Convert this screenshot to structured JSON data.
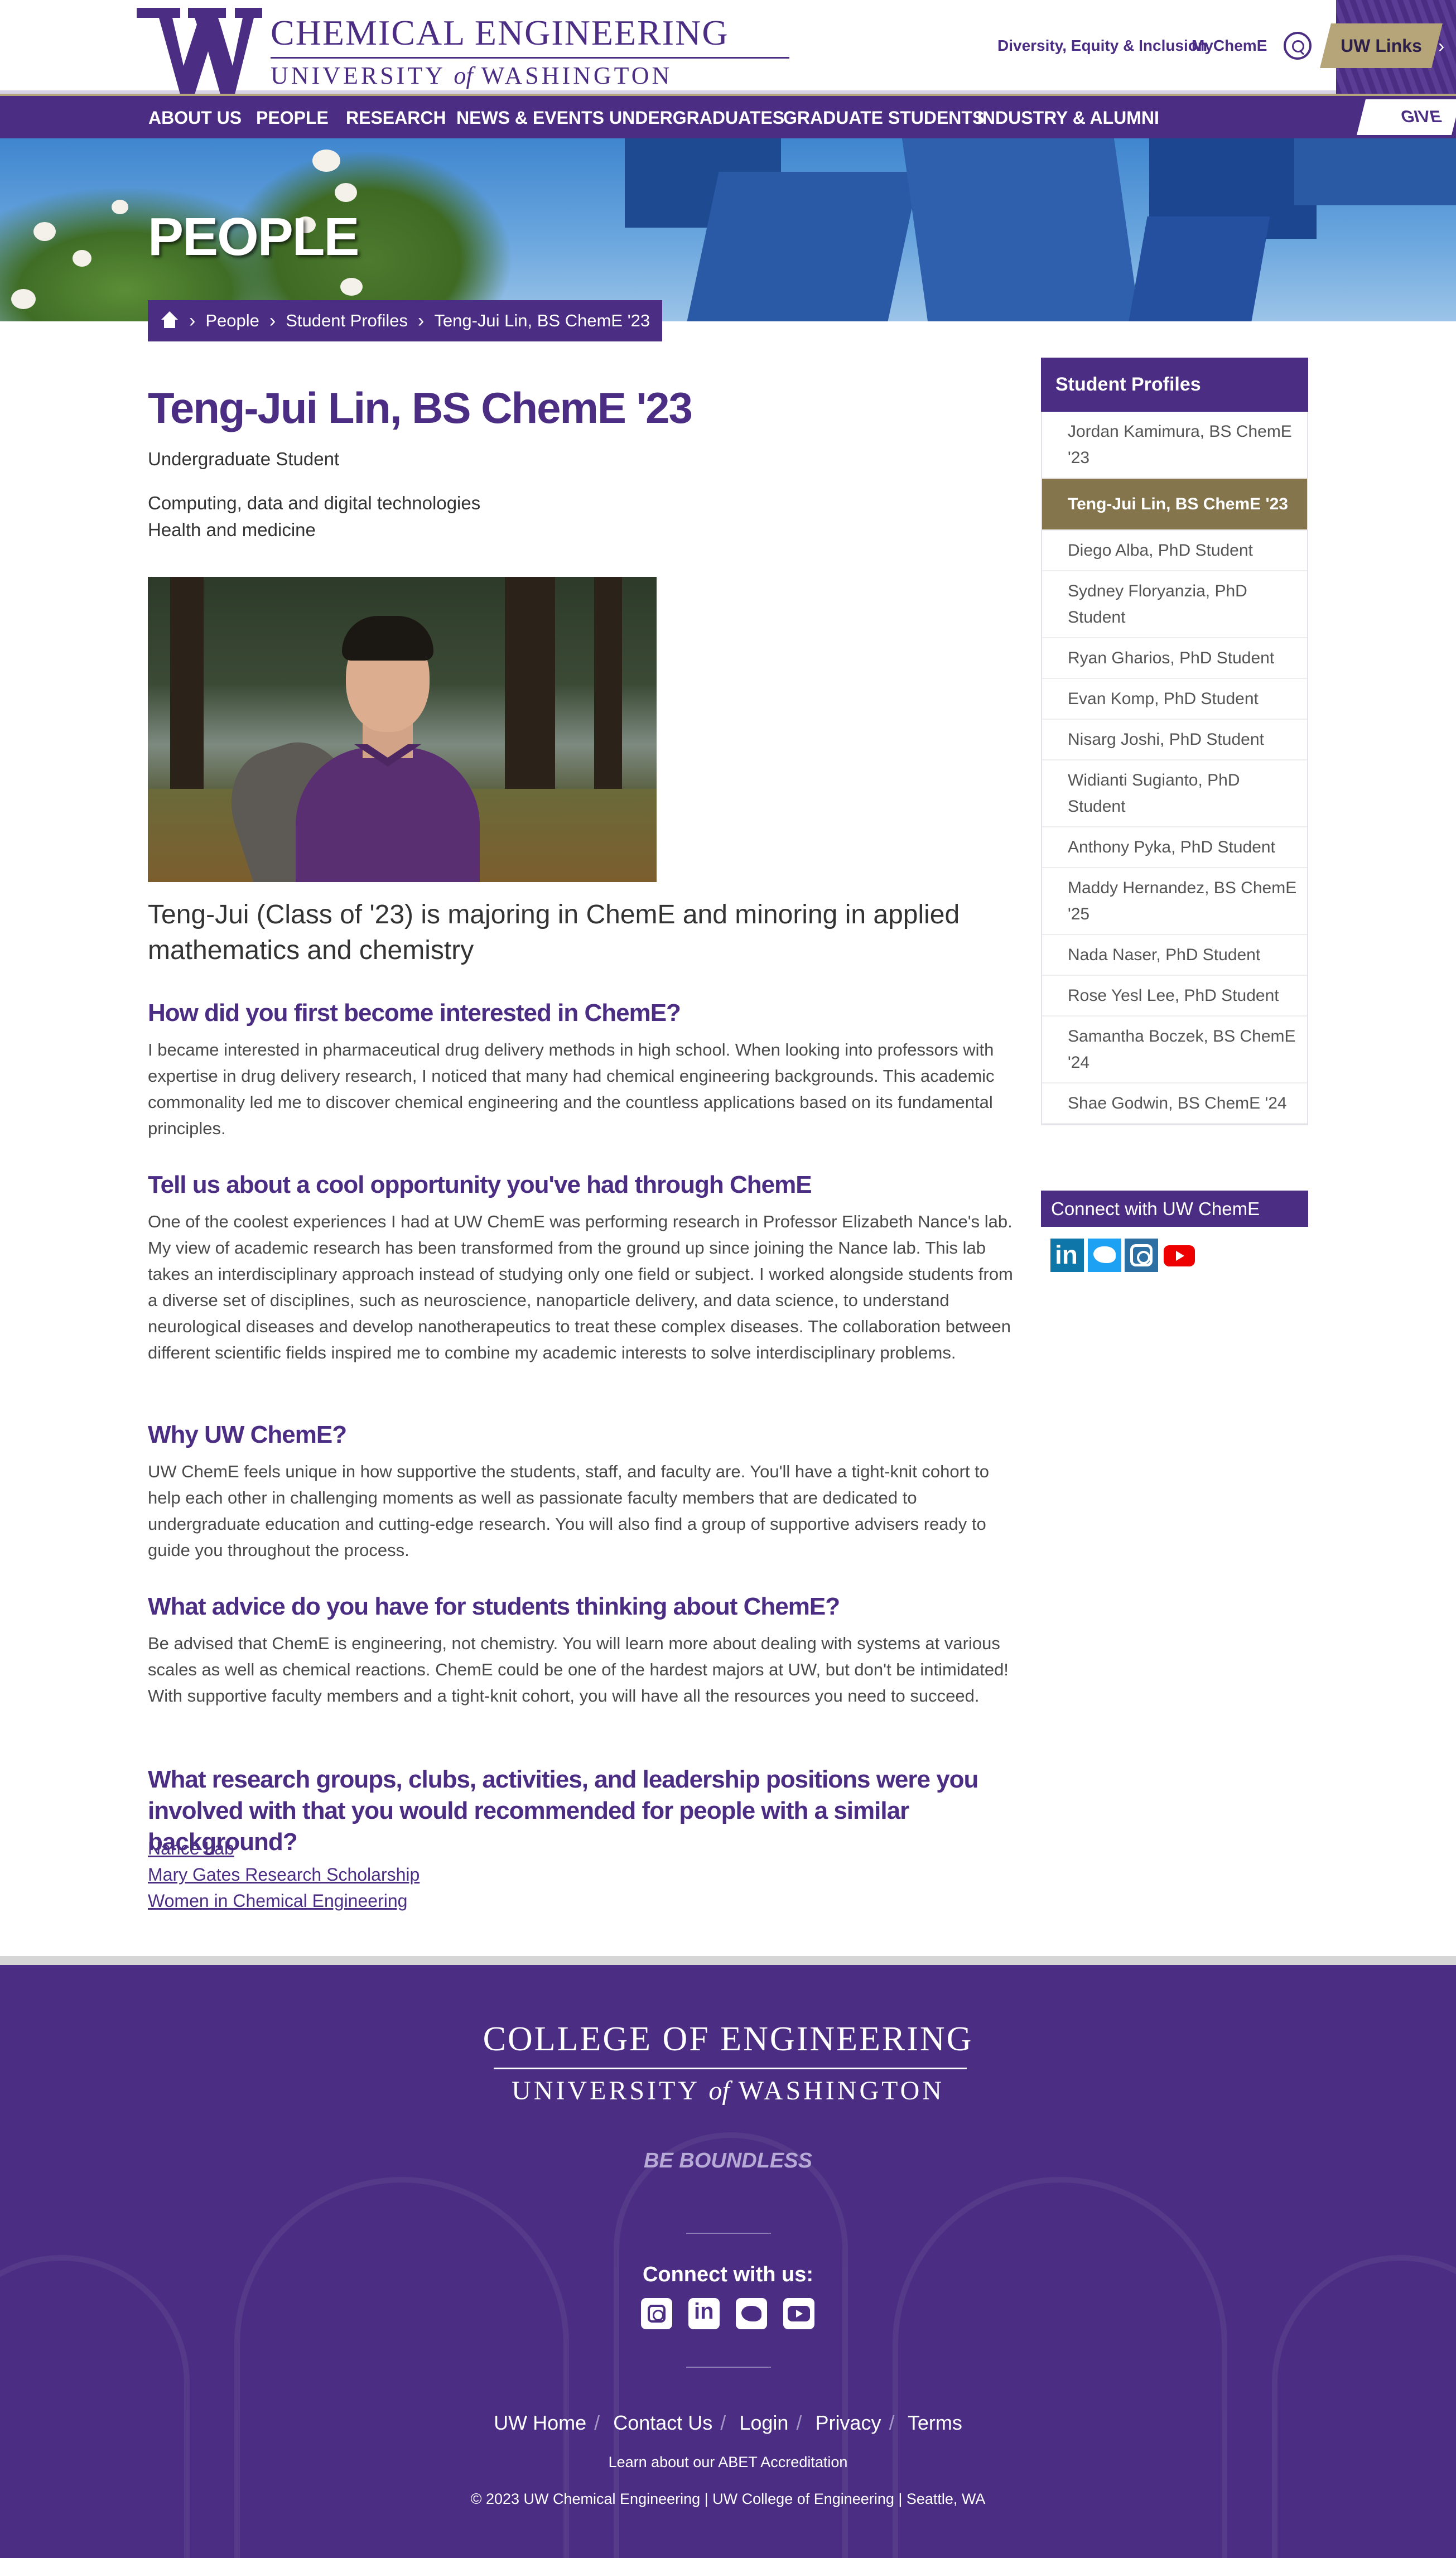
{
  "header": {
    "logo_line1": "CHEMICAL ENGINEERING",
    "logo_line2a": "UNIVERSITY ",
    "logo_line2b": "of",
    "logo_line2c": " WASHINGTON",
    "link_dei": "Diversity, Equity & Inclusion",
    "link_mycheme": "MyChemE",
    "uw_links": "UW Links",
    "give": "GIVE",
    "brand_purple": "#4b2e83",
    "brand_gold": "#b7a57a"
  },
  "nav": {
    "items": [
      "ABOUT US",
      "PEOPLE",
      "RESEARCH",
      "NEWS & EVENTS",
      "UNDERGRADUATES",
      "GRADUATE STUDENTS",
      "INDUSTRY & ALUMNI"
    ]
  },
  "hero": {
    "title": "PEOPLE"
  },
  "breadcrumb": [
    "People",
    "Student Profiles",
    "Teng-Jui Lin, BS ChemE '23"
  ],
  "profile": {
    "name": "Teng-Jui Lin, BS ChemE '23",
    "role": "Undergraduate Student",
    "tags": [
      "Computing, data and digital technologies",
      "Health and medicine"
    ],
    "intro": "Teng-Jui (Class of '23) is majoring in ChemE and minoring in applied mathematics and chemistry"
  },
  "qa": [
    {
      "q": "How did you first become interested in ChemE?",
      "a": "I became interested in pharmaceutical drug delivery methods in high school. When looking into professors with expertise in drug delivery research, I noticed that many had chemical engineering backgrounds. This academic commonality led me to discover chemical engineering and the countless applications based on its fundamental principles."
    },
    {
      "q": "Tell us about a cool opportunity you've had through ChemE",
      "a": "One of the coolest experiences I had at UW ChemE was performing research in Professor Elizabeth Nance's lab. My view of academic research has been transformed from the ground up since joining the Nance lab. This lab takes an interdisciplinary approach instead of studying only one field or subject. I worked alongside students from a diverse set of disciplines, such as neuroscience, nanoparticle delivery, and data science, to understand neurological diseases and develop nanotherapeutics to treat these complex diseases. The collaboration between different scientific fields inspired me to combine my academic interests to solve interdisciplinary problems."
    },
    {
      "q": "Why UW ChemE?",
      "a": "UW ChemE feels unique in how supportive the students, staff, and faculty are. You'll have a tight-knit cohort to help each other in challenging moments as well as passionate faculty members that are dedicated to undergraduate education and cutting-edge research. You will also find a group of supportive advisers ready to guide you throughout the process."
    },
    {
      "q": "What advice do you have for students thinking about ChemE?",
      "a": "Be advised that ChemE is engineering, not chemistry. You will learn more about dealing with systems at various scales as well as chemical reactions. ChemE could be one of the hardest majors at UW, but don't be intimidated! With supportive faculty members and a tight-knit cohort, you will have all the resources you need to succeed."
    },
    {
      "q": "What research groups, clubs, activities, and leadership positions were you involved with that you would recommended for people with a similar background?",
      "a": ""
    }
  ],
  "links": [
    "Nance Lab",
    "Mary Gates Research Scholarship",
    "Women in Chemical Engineering"
  ],
  "sidebar": {
    "title": "Student Profiles",
    "items": [
      "Jordan Kamimura, BS ChemE '23",
      "Teng-Jui Lin, BS ChemE '23",
      "Diego Alba, PhD Student",
      "Sydney Floryanzia, PhD Student",
      "Ryan Gharios, PhD Student",
      "Evan Komp, PhD Student",
      "Nisarg Joshi, PhD Student",
      "Widianti Sugianto, PhD Student",
      "Anthony Pyka, PhD Student",
      "Maddy Hernandez, BS ChemE '25",
      "Nada Naser, PhD Student",
      "Rose Yesl Lee, PhD Student",
      "Samantha Boczek, BS ChemE '24",
      "Shae Godwin, BS ChemE '24"
    ],
    "active_index": 1,
    "connect": "Connect with UW ChemE",
    "active_color": "#85754d"
  },
  "footer": {
    "coe_line1": "COLLEGE OF ENGINEERING",
    "coe_line2a": "UNIVERSITY ",
    "coe_line2b": "of",
    "coe_line2c": " WASHINGTON",
    "tagline": "BE BOUNDLESS",
    "connect": "Connect with us:",
    "links": [
      "UW Home",
      "Contact Us",
      "Login",
      "Privacy",
      "Terms"
    ],
    "abet": "Learn about our ABET Accreditation",
    "copyright": "© 2023 UW Chemical Engineering | UW College of Engineering | Seattle, WA"
  }
}
